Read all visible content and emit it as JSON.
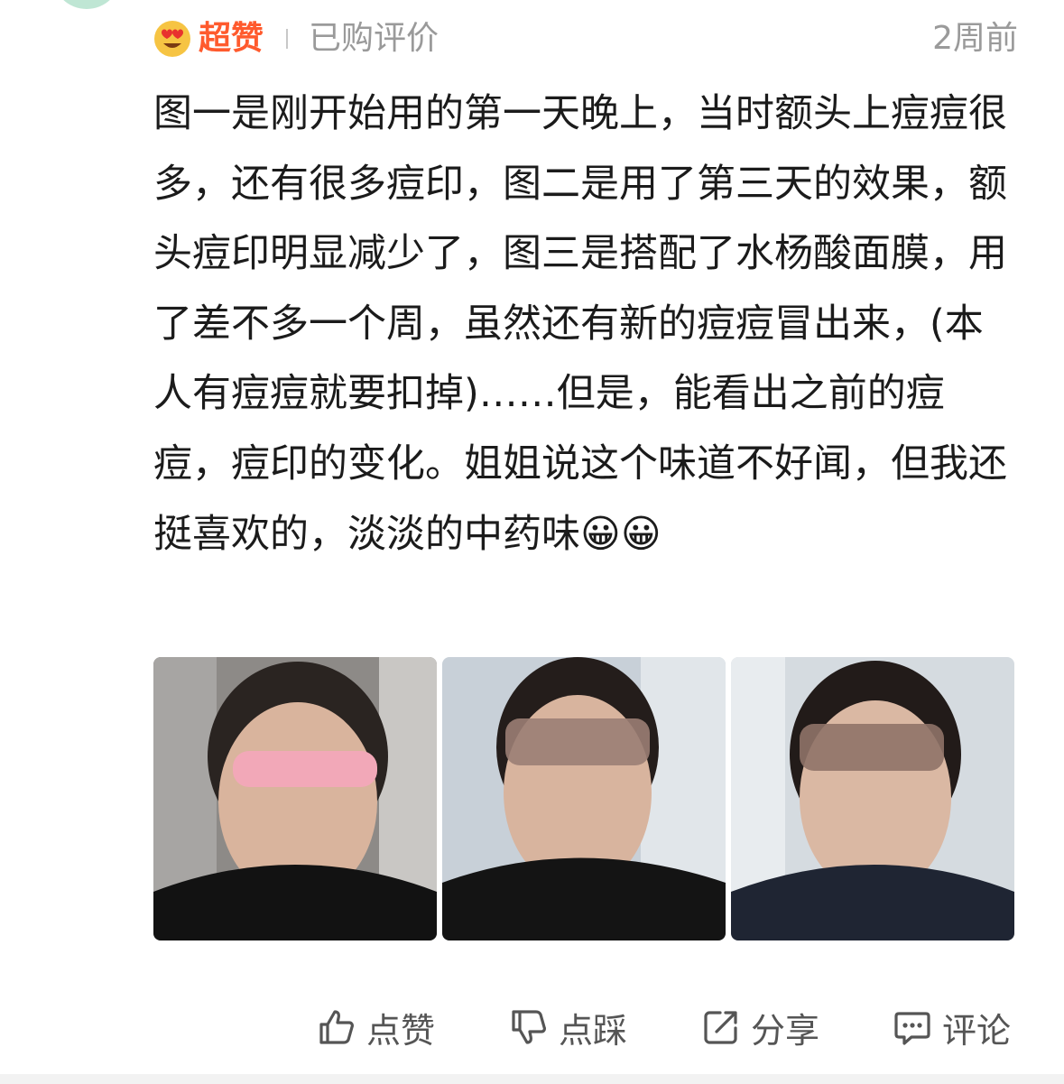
{
  "review": {
    "rating_label": "超赞",
    "purchase_tag": "已购评价",
    "time_ago": "2周前",
    "text": "图一是刚开始用的第一天晚上，当时额头上痘痘很多，还有很多痘印，图二是用了第三天的效果，额头痘印明显减少了，图三是搭配了水杨酸面膜，用了差不多一个周，虽然还有新的痘痘冒出来，(本人有痘痘就要扣掉)……但是，能看出之前的痘痘，痘印的变化。姐姐说这个味道不好闻，但我还挺喜欢的，淡淡的中药味😀😀",
    "photos": [
      {
        "icon": "review-photo-1"
      },
      {
        "icon": "review-photo-2"
      },
      {
        "icon": "review-photo-3"
      }
    ]
  },
  "actions": {
    "like": "点赞",
    "dislike": "点踩",
    "share": "分享",
    "comment": "评论"
  },
  "colors": {
    "accent": "#ff5a2d",
    "muted": "#9a9a9a",
    "text": "#1b1b1b"
  }
}
